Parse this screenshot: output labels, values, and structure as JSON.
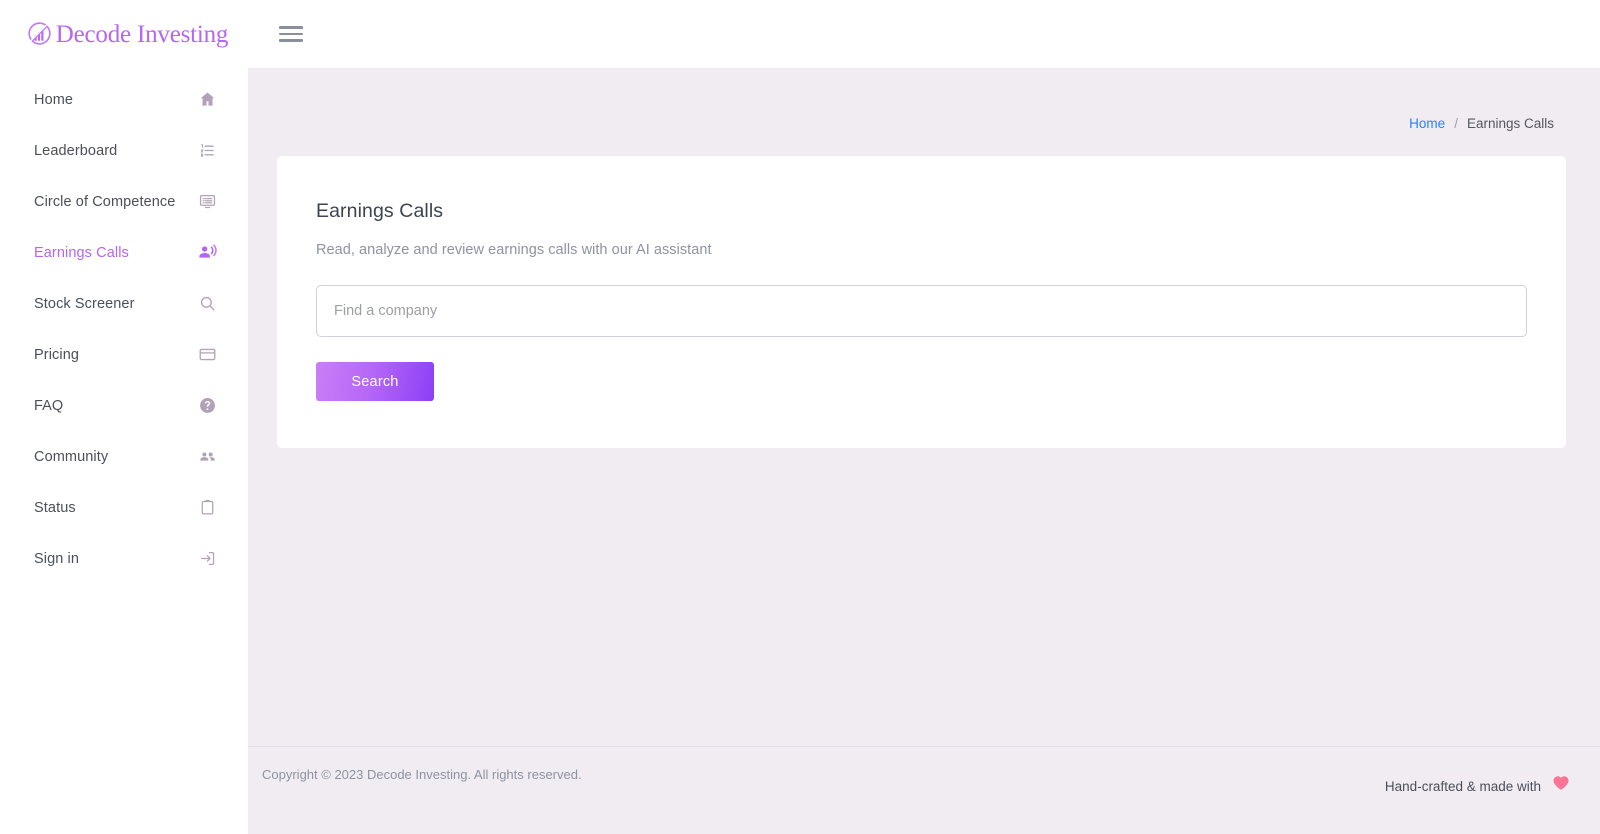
{
  "brand": {
    "name": "Decode Investing",
    "mark_icon": "chart-circle-logo-icon",
    "color": "#b766f2"
  },
  "topbar": {
    "menu_icon": "hamburger-menu-icon"
  },
  "sidebar": {
    "items": [
      {
        "label": "Home",
        "icon": "home-icon",
        "active": false
      },
      {
        "label": "Leaderboard",
        "icon": "ordered-list-icon",
        "active": false
      },
      {
        "label": "Circle of Competence",
        "icon": "monitor-list-icon",
        "active": false
      },
      {
        "label": "Earnings Calls",
        "icon": "record-voice-over-icon",
        "active": true
      },
      {
        "label": "Stock Screener",
        "icon": "search-icon",
        "active": false
      },
      {
        "label": "Pricing",
        "icon": "credit-card-icon",
        "active": false
      },
      {
        "label": "FAQ",
        "icon": "help-circle-icon",
        "active": false
      },
      {
        "label": "Community",
        "icon": "people-group-icon",
        "active": false
      },
      {
        "label": "Status",
        "icon": "clipboard-icon",
        "active": false
      },
      {
        "label": "Sign in",
        "icon": "login-arrow-icon",
        "active": false
      }
    ]
  },
  "breadcrumb": {
    "home_label": "Home",
    "separator": "/",
    "current_label": "Earnings Calls"
  },
  "main": {
    "title": "Earnings Calls",
    "subtitle": "Read, analyze and review earnings calls with our AI assistant",
    "search_placeholder": "Find a company",
    "search_value": "",
    "search_button_label": "Search",
    "button_gradient_from": "#cb7ef7",
    "button_gradient_to": "#8c3ff6"
  },
  "footer": {
    "copyright": "Copyright © 2023 Decode Investing. All rights reserved.",
    "made_with_text": "Hand-crafted & made with",
    "heart_icon": "heart-icon",
    "heart_color": "#fa7497"
  }
}
